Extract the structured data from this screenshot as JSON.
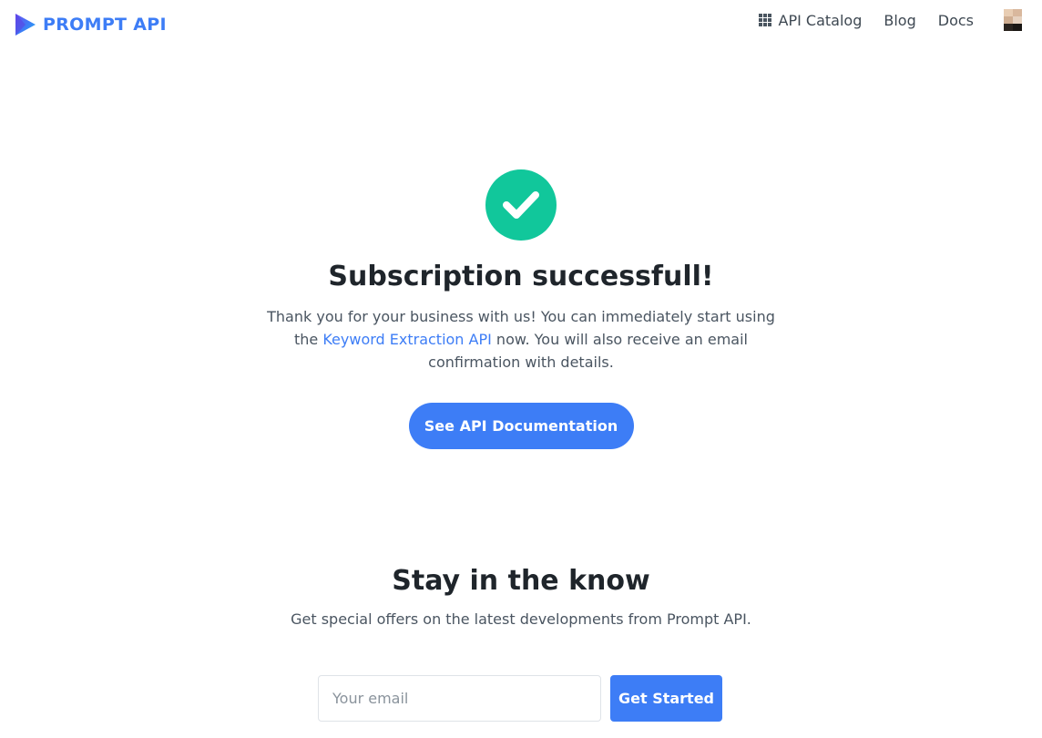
{
  "header": {
    "logo_text": "PROMPT API",
    "nav": {
      "catalog_label": "API Catalog",
      "blog_label": "Blog",
      "docs_label": "Docs"
    }
  },
  "success": {
    "icon": "check-circle-icon",
    "title": "Subscription successfull!",
    "desc_before": "Thank you for your business with us! You can immediately start using the ",
    "desc_link": "Keyword Extraction API",
    "desc_after": " now. You will also receive an email confirmation with details.",
    "button_label": "See API Documentation"
  },
  "newsletter": {
    "title": "Stay in the know",
    "subtitle": "Get special offers on the latest developments from Prompt API.",
    "email_placeholder": "Your email",
    "email_value": "",
    "submit_label": "Get Started"
  },
  "colors": {
    "accent": "#3d7df6",
    "success": "#11c79b"
  }
}
